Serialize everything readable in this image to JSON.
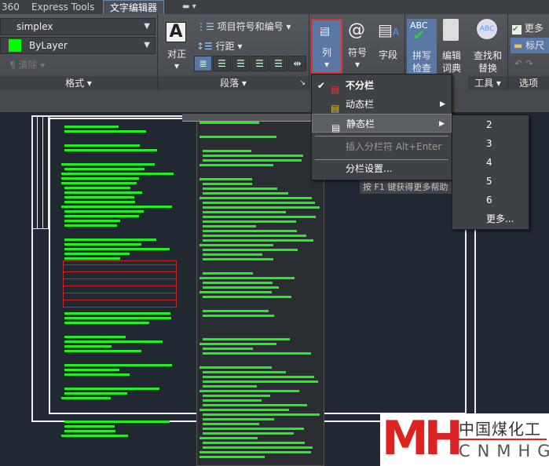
{
  "tabs": {
    "t360": "360",
    "express": "Express Tools",
    "editor": "文字编辑器"
  },
  "format": {
    "font": "simplex",
    "color": "ByLayer",
    "color_hex": "#00ff00",
    "clear": "清除",
    "panel": "格式"
  },
  "paragraph": {
    "justify": "对正",
    "bullets": "项目符号和编号",
    "spacing": "行距",
    "panel": "段落"
  },
  "insert": {
    "columns": "列",
    "symbol": "符号",
    "field": "字段"
  },
  "tools": {
    "spell": "拼写检查",
    "spell1": "拼写",
    "spell2": "检查",
    "dict1": "编辑",
    "dict2": "词典",
    "find1": "查找和",
    "find2": "替换",
    "panel": "工具"
  },
  "options": {
    "more": "更多",
    "ruler": "标尺",
    "panel": "选项"
  },
  "column_menu": {
    "no_columns": "不分栏",
    "dynamic": "动态栏",
    "static": "静态栏",
    "insert_break": "插入分栏符 Alt+Enter",
    "settings": "分栏设置..."
  },
  "static_submenu": [
    "2",
    "3",
    "4",
    "5",
    "6",
    "更多..."
  ],
  "tooltip": "按 F1 键获得更多帮助",
  "logo": {
    "mark": "MH",
    "cn": "中国煤化工",
    "en": "CNMHG"
  }
}
